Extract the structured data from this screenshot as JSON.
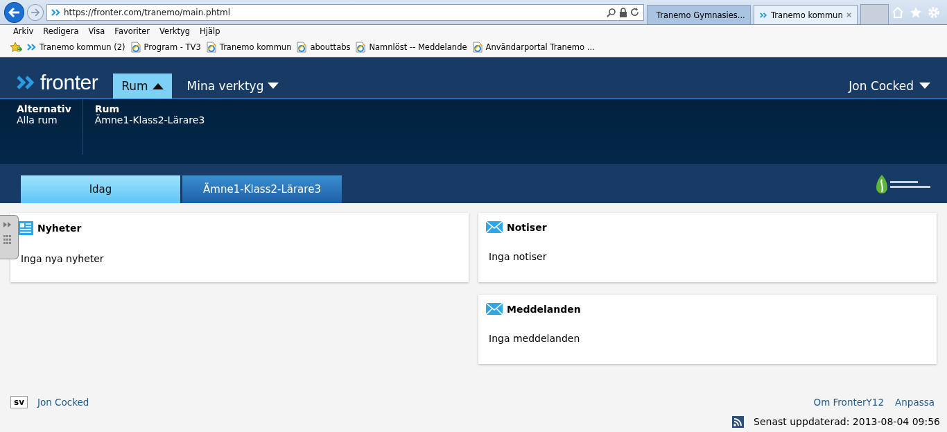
{
  "browser": {
    "address": "https://fronter.com/tranemo/main.phtml",
    "tabs": [
      {
        "label": "Tranemo Gymnasies...",
        "selected": false,
        "kind": "ie"
      },
      {
        "label": "Tranemo kommun",
        "selected": true,
        "kind": "fronter"
      }
    ],
    "menu": [
      "Arkiv",
      "Redigera",
      "Visa",
      "Favoriter",
      "Verktyg",
      "Hjälp"
    ],
    "favorites": [
      {
        "label": "Tranemo kommun (2)",
        "kind": "fronter"
      },
      {
        "label": "Program - TV3",
        "kind": "ie"
      },
      {
        "label": "Tranemo kommun",
        "kind": "ie"
      },
      {
        "label": "abouttabs",
        "kind": "ie"
      },
      {
        "label": "Namnlöst -- Meddelande",
        "kind": "ie"
      },
      {
        "label": "Användarportal Tranemo ...",
        "kind": "ie"
      }
    ]
  },
  "app": {
    "logo": "fronter",
    "nav": [
      {
        "label": "Rum",
        "selected": true
      },
      {
        "label": "Mina verktyg",
        "selected": false
      }
    ],
    "user": "Jon Cocked",
    "subpanel": [
      {
        "heading": "Alternativ",
        "item": "Alla rum"
      },
      {
        "heading": "Rum",
        "item": "Ämne1-Klass2-Lärare3"
      }
    ],
    "tabs": [
      {
        "label": "Idag",
        "selected": true
      },
      {
        "label": "Ämne1-Klass2-Lärare3",
        "selected": false
      }
    ]
  },
  "columns": [
    [
      {
        "title": "Nyheter",
        "kind": "news",
        "body": "Inga nya nyheter"
      }
    ],
    [
      {
        "title": "Notiser",
        "kind": "mail",
        "body": "Inga notiser"
      },
      {
        "title": "Meddelanden",
        "kind": "mail",
        "body": "Inga meddelanden"
      }
    ]
  ],
  "footer": {
    "language": "sv",
    "user": "Jon Cocked",
    "links": [
      "Om FronterY12",
      "Anpassa"
    ],
    "updated": "Senast uppdaterad: 2013-08-04 09:56"
  }
}
